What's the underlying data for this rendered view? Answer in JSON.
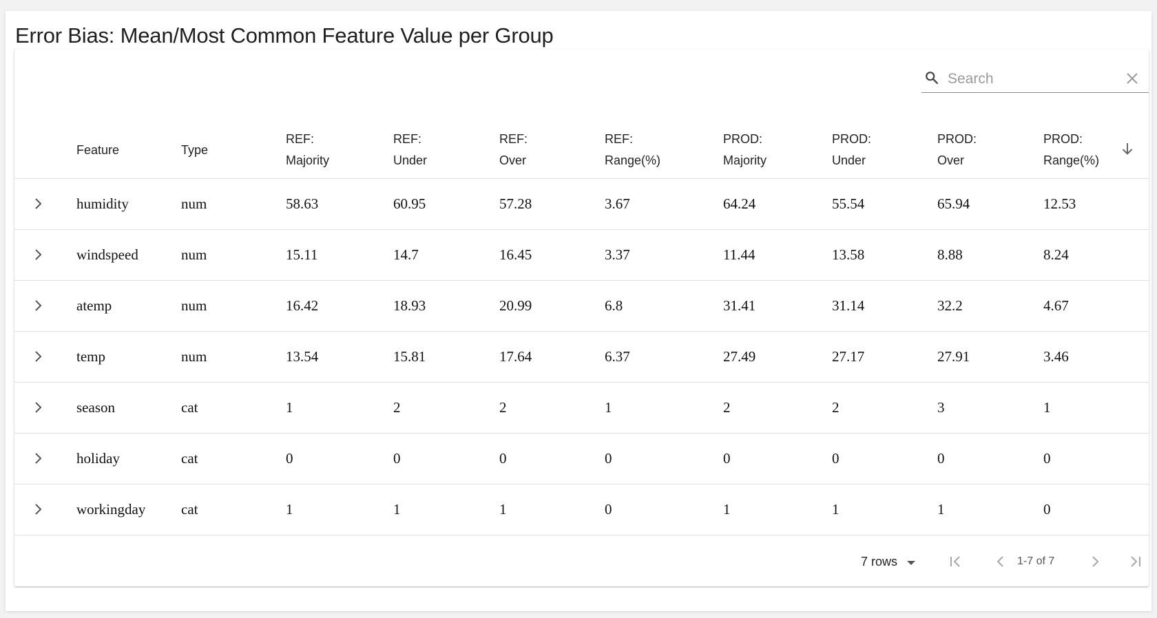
{
  "title": "Error Bias: Mean/Most Common Feature Value per Group",
  "search": {
    "placeholder": "Search",
    "value": ""
  },
  "columns": [
    {
      "line1": "Feature",
      "line2": ""
    },
    {
      "line1": "Type",
      "line2": ""
    },
    {
      "line1": "REF:",
      "line2": "Majority"
    },
    {
      "line1": "REF:",
      "line2": "Under"
    },
    {
      "line1": "REF:",
      "line2": "Over"
    },
    {
      "line1": "REF:",
      "line2": "Range(%)"
    },
    {
      "line1": "PROD:",
      "line2": "Majority"
    },
    {
      "line1": "PROD:",
      "line2": "Under"
    },
    {
      "line1": "PROD:",
      "line2": "Over"
    },
    {
      "line1": "PROD:",
      "line2": "Range(%)"
    }
  ],
  "sort": {
    "column": "PROD: Range(%)",
    "direction": "descending",
    "icon": "arrow-down-icon"
  },
  "rows": [
    [
      "humidity",
      "num",
      "58.63",
      "60.95",
      "57.28",
      "3.67",
      "64.24",
      "55.54",
      "65.94",
      "12.53"
    ],
    [
      "windspeed",
      "num",
      "15.11",
      "14.7",
      "16.45",
      "3.37",
      "11.44",
      "13.58",
      "8.88",
      "8.24"
    ],
    [
      "atemp",
      "num",
      "16.42",
      "18.93",
      "20.99",
      "6.8",
      "31.41",
      "31.14",
      "32.2",
      "4.67"
    ],
    [
      "temp",
      "num",
      "13.54",
      "15.81",
      "17.64",
      "6.37",
      "27.49",
      "27.17",
      "27.91",
      "3.46"
    ],
    [
      "season",
      "cat",
      "1",
      "2",
      "2",
      "1",
      "2",
      "2",
      "3",
      "1"
    ],
    [
      "holiday",
      "cat",
      "0",
      "0",
      "0",
      "0",
      "0",
      "0",
      "0",
      "0"
    ],
    [
      "workingday",
      "cat",
      "1",
      "1",
      "1",
      "0",
      "1",
      "1",
      "1",
      "0"
    ]
  ],
  "pagination": {
    "rows_per_page": "7 rows",
    "range_label": "1-7 of 7"
  }
}
